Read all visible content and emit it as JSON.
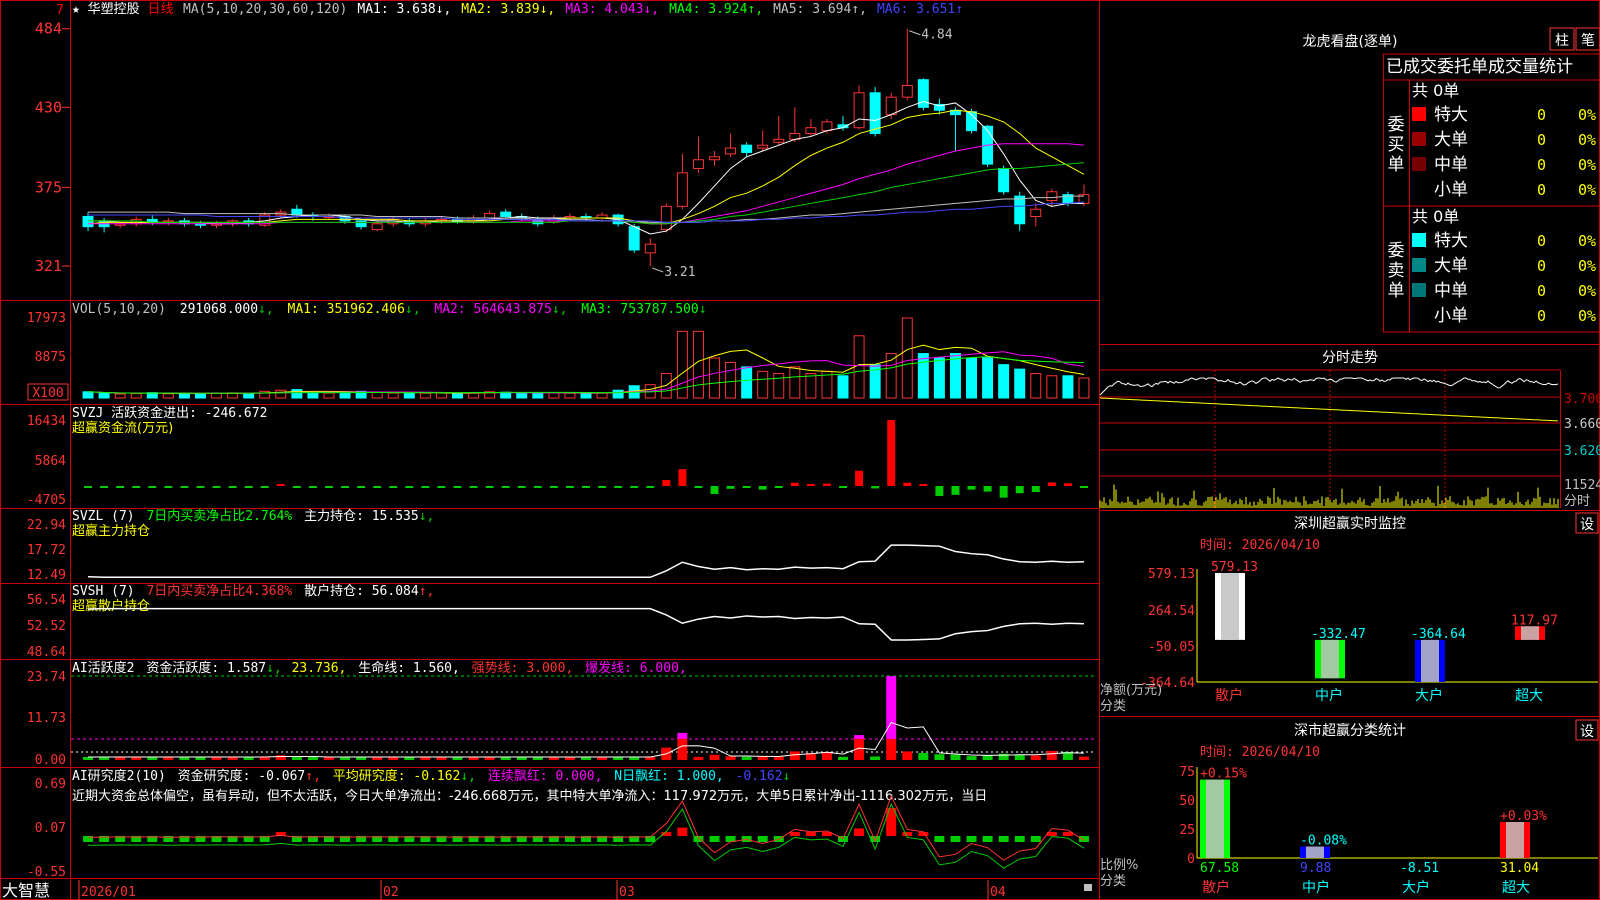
{
  "colors": {
    "bg": "#000000",
    "frame": "#cc0000",
    "up": "#ff0000",
    "down": "#00ffff",
    "green": "#00cc00",
    "white": "#ffffff",
    "yellow": "#ffff00",
    "magenta": "#ff00ff",
    "blue": "#0000ff",
    "text": "#c0c0c0",
    "axis": "#ff3333"
  },
  "main": {
    "star": "★",
    "name": "华塑控股",
    "period": "日线",
    "ma_items": [
      {
        "label": "MA(5,10,20,30,60,120)",
        "color": "#c0c0c0",
        "arrow": ""
      },
      {
        "label": "MA1: 3.638",
        "color": "#ffffff",
        "arrow": "↓"
      },
      {
        "label": "MA2: 3.839",
        "color": "#ffff00",
        "arrow": "↓"
      },
      {
        "label": "MA3: 4.043",
        "color": "#ff00ff",
        "arrow": "↓"
      },
      {
        "label": "MA4: 3.924",
        "color": "#00ff00",
        "arrow": "↑"
      },
      {
        "label": "MA5: 3.694",
        "color": "#c0c0c0",
        "arrow": "↑"
      },
      {
        "label": "MA6: 3.651",
        "color": "#4444ff",
        "arrow": "↑"
      }
    ],
    "flag_num": "7",
    "high_label": "4.84",
    "low_label": "3.21",
    "y_ticks": [
      "484",
      "430",
      "375",
      "321"
    ]
  },
  "vol": {
    "title": "VOL(5,10,20)",
    "value": "291068.000",
    "ma1": "MA1: 351962.406",
    "ma2": "MA2: 564643.875",
    "ma3": "MA3: 753787.500",
    "y_ticks": [
      "17973",
      "8875"
    ],
    "unit": "X100"
  },
  "svzj": {
    "title": "SVZJ  活跃资金进出: -246.672",
    "sub": "超赢资金流(万元)",
    "y_ticks": [
      "16434",
      "5864",
      "-4705"
    ]
  },
  "svzl": {
    "title": "SVZL (7)",
    "t2": "7日内买卖净占比2.764%",
    "t3": "主力持仓: 15.535",
    "sub": "超赢主力持仓",
    "y_ticks": [
      "22.94",
      "17.72",
      "12.49"
    ]
  },
  "svsh": {
    "title": "SVSH (7)",
    "t2": "7日内买卖净占比4.368%",
    "t3": "散户持仓: 56.084",
    "sub": "超赢散户持仓",
    "y_ticks": [
      "56.54",
      "52.52",
      "48.64"
    ]
  },
  "ai1": {
    "title": "AI活跃度2",
    "t1": "资金活跃度: 1.587",
    "t2": "23.736,",
    "t3": "生命线: 1.560,",
    "t4": "强势线: 3.000,",
    "t5": "爆发线: 6.000,",
    "y_ticks": [
      "23.74",
      "11.73",
      "0.00"
    ]
  },
  "ai2": {
    "title": "AI研究度2(10)",
    "t1": "资金研究度: -0.067",
    "t2": "平均研究度: -0.162",
    "t3": "连续飘红: 0.000,",
    "t4": "N日飘红: 1.000,",
    "t5": "-0.162",
    "note": "近期大资金总体偏空，虽有异动，但不太活跃，今日大单净流出：-246.668万元，其中特大单净流入：117.972万元，大单5日累计净出-1116.302万元，当日",
    "y_ticks": [
      "0.69",
      "0.07",
      "-0.55"
    ]
  },
  "xaxis": {
    "brand": "大智慧",
    "labels": [
      "2026/01",
      "02",
      "03",
      "04"
    ]
  },
  "dragon": {
    "title": "龙虎看盘(逐单)",
    "btn1": "柱",
    "btn2": "笔",
    "header": "已成交委托单成交量统计",
    "buy": {
      "side": "委买单",
      "total": "共 0单",
      "rows": [
        {
          "name": "特大",
          "count": "0",
          "pct": "0%",
          "color": "#ff0000"
        },
        {
          "name": "大单",
          "count": "0",
          "pct": "0%",
          "color": "#990000"
        },
        {
          "name": "中单",
          "count": "0",
          "pct": "0%",
          "color": "#770000"
        },
        {
          "name": "小单",
          "count": "0",
          "pct": "0%",
          "color": "#000000"
        }
      ]
    },
    "sell": {
      "side": "委卖单",
      "total": "共 0单",
      "rows": [
        {
          "name": "特大",
          "count": "0",
          "pct": "0%",
          "color": "#00ffff"
        },
        {
          "name": "大单",
          "count": "0",
          "pct": "0%",
          "color": "#008888"
        },
        {
          "name": "中单",
          "count": "0",
          "pct": "0%",
          "color": "#007777"
        },
        {
          "name": "小单",
          "count": "0",
          "pct": "0%",
          "color": "#000000"
        }
      ]
    }
  },
  "intraday": {
    "title": "分时走势",
    "y_ticks": [
      "3.700",
      "3.660",
      "3.620"
    ],
    "vol_tick": "11524",
    "unit": "分时"
  },
  "monitor": {
    "title": "深圳超赢实时监控",
    "set": "设",
    "time": "时间: 2026/04/10",
    "y_ticks": [
      "579.13",
      "264.54",
      "-50.05",
      "-364.64"
    ],
    "axis_label1": "净额(万元)",
    "axis_label2": "分类",
    "bars": [
      {
        "cat": "散户",
        "value": 579.13,
        "label": "579.13"
      },
      {
        "cat": "中户",
        "value": -332.47,
        "label": "-332.47"
      },
      {
        "cat": "大户",
        "value": -364.64,
        "label": "-364.64"
      },
      {
        "cat": "超大",
        "value": 117.97,
        "label": "117.97"
      }
    ]
  },
  "classify": {
    "title": "深市超赢分类统计",
    "set": "设",
    "time": "时间: 2026/04/10",
    "y_ticks": [
      "75",
      "50",
      "25",
      "0"
    ],
    "axis_label1": "比例%",
    "axis_label2": "分类",
    "bars": [
      {
        "cat": "散户",
        "value": 67.58,
        "label": "67.58",
        "delta": "+0.15%"
      },
      {
        "cat": "中户",
        "value": 9.88,
        "label": "9.88",
        "delta": "-0.08%"
      },
      {
        "cat": "大户",
        "value": -8.51,
        "label": "-8.51",
        "delta": ""
      },
      {
        "cat": "超大",
        "value": 31.04,
        "label": "31.04",
        "delta": "+0.03%"
      }
    ]
  },
  "chart_data": {
    "type": "candlestick",
    "price_axis": {
      "ylim": [
        3.1,
        4.9
      ]
    },
    "candles": [
      [
        3.55,
        3.48,
        3.58,
        3.45
      ],
      [
        3.52,
        3.48,
        3.54,
        3.44
      ],
      [
        3.49,
        3.5,
        3.52,
        3.47
      ],
      [
        3.5,
        3.53,
        3.55,
        3.48
      ],
      [
        3.53,
        3.51,
        3.56,
        3.49
      ],
      [
        3.51,
        3.52,
        3.54,
        3.49
      ],
      [
        3.52,
        3.5,
        3.54,
        3.48
      ],
      [
        3.5,
        3.49,
        3.52,
        3.47
      ],
      [
        3.49,
        3.5,
        3.52,
        3.47
      ],
      [
        3.5,
        3.52,
        3.53,
        3.48
      ],
      [
        3.52,
        3.5,
        3.54,
        3.48
      ],
      [
        3.49,
        3.56,
        3.58,
        3.48
      ],
      [
        3.56,
        3.58,
        3.6,
        3.54
      ],
      [
        3.6,
        3.56,
        3.63,
        3.54
      ],
      [
        3.56,
        3.55,
        3.58,
        3.52
      ],
      [
        3.55,
        3.55,
        3.57,
        3.53
      ],
      [
        3.55,
        3.52,
        3.56,
        3.5
      ],
      [
        3.52,
        3.48,
        3.53,
        3.46
      ],
      [
        3.46,
        3.5,
        3.52,
        3.45
      ],
      [
        3.5,
        3.53,
        3.55,
        3.48
      ],
      [
        3.52,
        3.5,
        3.54,
        3.48
      ],
      [
        3.5,
        3.52,
        3.54,
        3.48
      ],
      [
        3.52,
        3.53,
        3.55,
        3.5
      ],
      [
        3.53,
        3.51,
        3.55,
        3.5
      ],
      [
        3.51,
        3.54,
        3.56,
        3.5
      ],
      [
        3.54,
        3.57,
        3.59,
        3.53
      ],
      [
        3.58,
        3.55,
        3.6,
        3.53
      ],
      [
        3.55,
        3.54,
        3.57,
        3.52
      ],
      [
        3.53,
        3.5,
        3.55,
        3.48
      ],
      [
        3.51,
        3.54,
        3.56,
        3.5
      ],
      [
        3.54,
        3.55,
        3.57,
        3.52
      ],
      [
        3.55,
        3.54,
        3.57,
        3.52
      ],
      [
        3.54,
        3.56,
        3.58,
        3.52
      ],
      [
        3.56,
        3.5,
        3.57,
        3.48
      ],
      [
        3.48,
        3.32,
        3.5,
        3.3
      ],
      [
        3.3,
        3.36,
        3.4,
        3.21
      ],
      [
        3.46,
        3.62,
        3.64,
        3.44
      ],
      [
        3.62,
        3.85,
        3.98,
        3.6
      ],
      [
        3.88,
        3.94,
        4.1,
        3.85
      ],
      [
        3.94,
        3.96,
        4.0,
        3.9
      ],
      [
        3.98,
        4.02,
        4.12,
        3.96
      ],
      [
        4.04,
        3.99,
        4.06,
        3.96
      ],
      [
        4.02,
        4.04,
        4.14,
        4.0
      ],
      [
        4.06,
        4.08,
        4.24,
        4.04
      ],
      [
        4.08,
        4.12,
        4.3,
        4.06
      ],
      [
        4.12,
        4.16,
        4.22,
        4.1
      ],
      [
        4.14,
        4.2,
        4.22,
        4.12
      ],
      [
        4.18,
        4.16,
        4.24,
        4.14
      ],
      [
        4.16,
        4.4,
        4.45,
        4.15
      ],
      [
        4.4,
        4.12,
        4.44,
        4.1
      ],
      [
        4.25,
        4.37,
        4.4,
        4.22
      ],
      [
        4.37,
        4.45,
        4.84,
        4.35
      ],
      [
        4.49,
        4.3,
        4.5,
        4.28
      ],
      [
        4.32,
        4.28,
        4.36,
        4.25
      ],
      [
        4.28,
        4.25,
        4.3,
        4.0
      ],
      [
        4.27,
        4.14,
        4.29,
        4.12
      ],
      [
        4.17,
        3.91,
        4.18,
        3.89
      ],
      [
        3.88,
        3.72,
        3.9,
        3.7
      ],
      [
        3.69,
        3.5,
        3.72,
        3.45
      ],
      [
        3.55,
        3.6,
        3.64,
        3.48
      ],
      [
        3.66,
        3.72,
        3.74,
        3.62
      ],
      [
        3.7,
        3.64,
        3.72,
        3.62
      ],
      [
        3.64,
        3.7,
        3.77,
        3.62
      ]
    ],
    "ma_series": [
      {
        "name": "MA1",
        "color": "#ffffff",
        "values": [
          3.52,
          3.52,
          3.51,
          3.51,
          3.51,
          3.51,
          3.51,
          3.51,
          3.5,
          3.5,
          3.51,
          3.52,
          3.54,
          3.55,
          3.56,
          3.56,
          3.55,
          3.53,
          3.52,
          3.52,
          3.51,
          3.51,
          3.52,
          3.52,
          3.52,
          3.53,
          3.54,
          3.55,
          3.54,
          3.54,
          3.54,
          3.54,
          3.54,
          3.53,
          3.48,
          3.43,
          3.45,
          3.53,
          3.64,
          3.76,
          3.88,
          3.96,
          4.0,
          4.04,
          4.08,
          4.1,
          4.14,
          4.16,
          4.22,
          4.21,
          4.25,
          4.3,
          4.34,
          4.31,
          4.33,
          4.25,
          4.14,
          3.98,
          3.8,
          3.66,
          3.62,
          3.64,
          3.64
        ]
      },
      {
        "name": "MA2",
        "color": "#ffff00",
        "values": [
          3.5,
          3.51,
          3.51,
          3.51,
          3.51,
          3.51,
          3.51,
          3.51,
          3.51,
          3.51,
          3.51,
          3.51,
          3.52,
          3.53,
          3.53,
          3.53,
          3.53,
          3.53,
          3.53,
          3.53,
          3.52,
          3.52,
          3.52,
          3.52,
          3.52,
          3.52,
          3.53,
          3.53,
          3.53,
          3.53,
          3.54,
          3.54,
          3.54,
          3.54,
          3.52,
          3.5,
          3.5,
          3.53,
          3.57,
          3.62,
          3.68,
          3.71,
          3.76,
          3.82,
          3.9,
          3.97,
          4.02,
          4.06,
          4.12,
          4.15,
          4.18,
          4.23,
          4.25,
          4.26,
          4.28,
          4.27,
          4.24,
          4.2,
          4.12,
          4.02,
          3.96,
          3.9,
          3.84
        ]
      },
      {
        "name": "MA3",
        "color": "#ff00ff",
        "values": [
          3.5,
          3.5,
          3.5,
          3.5,
          3.5,
          3.5,
          3.5,
          3.5,
          3.5,
          3.5,
          3.5,
          3.5,
          3.51,
          3.51,
          3.51,
          3.51,
          3.51,
          3.51,
          3.51,
          3.51,
          3.51,
          3.51,
          3.51,
          3.51,
          3.51,
          3.51,
          3.51,
          3.52,
          3.52,
          3.52,
          3.52,
          3.52,
          3.52,
          3.52,
          3.51,
          3.5,
          3.5,
          3.51,
          3.53,
          3.55,
          3.57,
          3.59,
          3.62,
          3.65,
          3.68,
          3.71,
          3.74,
          3.77,
          3.81,
          3.84,
          3.87,
          3.91,
          3.94,
          3.97,
          4.0,
          4.02,
          4.04,
          4.05,
          4.05,
          4.05,
          4.05,
          4.05,
          4.04
        ]
      },
      {
        "name": "MA4",
        "color": "#00cc00",
        "values": [
          3.52,
          3.52,
          3.52,
          3.52,
          3.51,
          3.51,
          3.51,
          3.51,
          3.51,
          3.51,
          3.51,
          3.51,
          3.51,
          3.51,
          3.51,
          3.51,
          3.51,
          3.51,
          3.51,
          3.51,
          3.51,
          3.51,
          3.51,
          3.51,
          3.51,
          3.51,
          3.51,
          3.51,
          3.51,
          3.51,
          3.52,
          3.52,
          3.52,
          3.52,
          3.51,
          3.5,
          3.5,
          3.51,
          3.52,
          3.53,
          3.55,
          3.56,
          3.58,
          3.6,
          3.62,
          3.64,
          3.66,
          3.68,
          3.7,
          3.72,
          3.75,
          3.77,
          3.79,
          3.81,
          3.83,
          3.85,
          3.87,
          3.88,
          3.88,
          3.89,
          3.9,
          3.91,
          3.92
        ]
      },
      {
        "name": "MA5",
        "color": "#c0c0c0",
        "values": [
          3.58,
          3.58,
          3.58,
          3.58,
          3.58,
          3.58,
          3.57,
          3.57,
          3.57,
          3.57,
          3.57,
          3.57,
          3.57,
          3.56,
          3.56,
          3.56,
          3.56,
          3.56,
          3.55,
          3.55,
          3.55,
          3.55,
          3.55,
          3.54,
          3.54,
          3.54,
          3.54,
          3.54,
          3.53,
          3.53,
          3.53,
          3.53,
          3.52,
          3.52,
          3.52,
          3.51,
          3.51,
          3.51,
          3.51,
          3.52,
          3.52,
          3.53,
          3.53,
          3.54,
          3.55,
          3.56,
          3.56,
          3.57,
          3.58,
          3.59,
          3.6,
          3.61,
          3.62,
          3.63,
          3.64,
          3.65,
          3.66,
          3.67,
          3.67,
          3.68,
          3.68,
          3.69,
          3.69
        ]
      },
      {
        "name": "MA6",
        "color": "#4444ff",
        "values": [
          3.56,
          3.56,
          3.56,
          3.56,
          3.56,
          3.56,
          3.56,
          3.56,
          3.55,
          3.55,
          3.55,
          3.55,
          3.55,
          3.55,
          3.55,
          3.55,
          3.54,
          3.54,
          3.54,
          3.54,
          3.54,
          3.54,
          3.54,
          3.53,
          3.53,
          3.53,
          3.53,
          3.53,
          3.53,
          3.53,
          3.52,
          3.52,
          3.52,
          3.52,
          3.52,
          3.52,
          3.51,
          3.51,
          3.51,
          3.52,
          3.52,
          3.52,
          3.53,
          3.53,
          3.54,
          3.54,
          3.55,
          3.55,
          3.56,
          3.56,
          3.57,
          3.58,
          3.58,
          3.59,
          3.6,
          3.6,
          3.61,
          3.62,
          3.62,
          3.63,
          3.64,
          3.64,
          3.65
        ]
      }
    ],
    "volume": [
      28,
      22,
      18,
      20,
      24,
      19,
      22,
      20,
      21,
      23,
      20,
      30,
      35,
      38,
      25,
      22,
      24,
      30,
      26,
      22,
      20,
      22,
      24,
      20,
      25,
      28,
      26,
      22,
      21,
      24,
      22,
      20,
      23,
      35,
      55,
      60,
      110,
      300,
      300,
      180,
      160,
      140,
      120,
      110,
      140,
      110,
      120,
      100,
      280,
      150,
      200,
      360,
      200,
      180,
      200,
      180,
      180,
      150,
      130,
      110,
      100,
      100,
      90
    ],
    "fund_flow": [
      -150,
      -140,
      -120,
      -130,
      -110,
      -150,
      -120,
      -130,
      -100,
      -110,
      -120,
      -100,
      80,
      -130,
      -90,
      -110,
      -140,
      -120,
      -100,
      -130,
      -110,
      -100,
      -120,
      -140,
      -100,
      -120,
      -130,
      -110,
      -120,
      -100,
      -130,
      -120,
      -110,
      -150,
      -100,
      -130,
      1500,
      4200,
      -200,
      -2000,
      -700,
      -400,
      -900,
      -400,
      800,
      500,
      600,
      -300,
      3800,
      -600,
      16434,
      800,
      500,
      -2500,
      -2200,
      -900,
      -1400,
      -2900,
      -1800,
      -1500,
      900,
      700,
      -500
    ],
    "svzl": [
      13.1,
      13.0,
      13.0,
      13.0,
      13.0,
      13.0,
      13.0,
      13.0,
      13.0,
      13.0,
      13.0,
      13.0,
      13.0,
      13.0,
      13.0,
      13.0,
      13.0,
      13.0,
      13.0,
      13.0,
      13.0,
      13.0,
      13.0,
      13.0,
      13.0,
      13.0,
      13.0,
      13.0,
      13.0,
      13.0,
      13.0,
      13.0,
      13.0,
      13.0,
      13.0,
      13.0,
      14.2,
      15.8,
      15.0,
      14.5,
      14.8,
      14.4,
      14.6,
      14.5,
      14.9,
      14.7,
      14.8,
      14.6,
      15.9,
      16.0,
      19.0,
      19.0,
      18.9,
      18.8,
      17.8,
      17.4,
      17.2,
      16.4,
      15.9,
      15.8,
      16.0,
      15.8,
      15.9
    ]
  }
}
